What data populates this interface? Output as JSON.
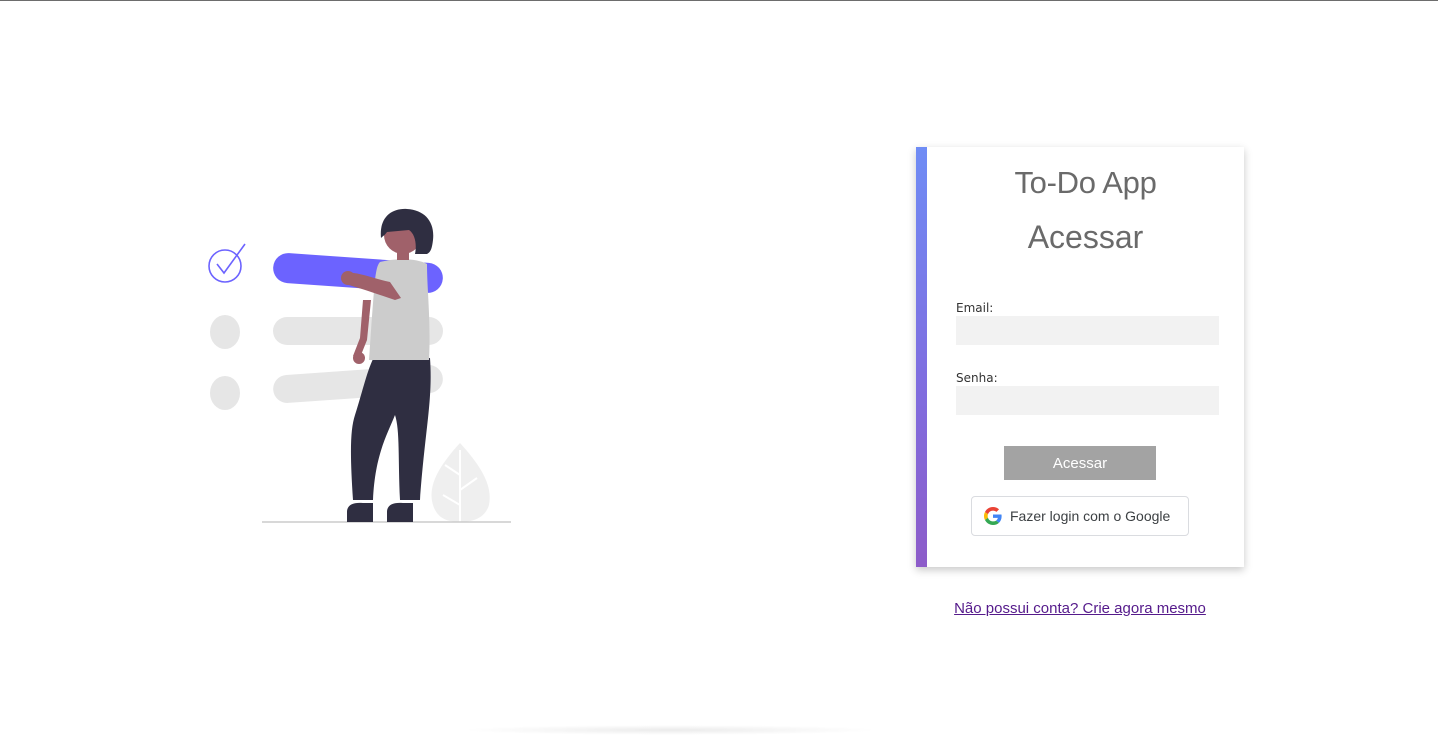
{
  "app": {
    "title": "To-Do App",
    "heading": "Acessar"
  },
  "form": {
    "email_label": "Email:",
    "email_value": "",
    "password_label": "Senha:",
    "password_value": "",
    "submit_label": "Acessar",
    "google_label": "Fazer login com o Google"
  },
  "footer": {
    "signup_link": "Não possui conta? Crie agora mesmo"
  },
  "colors": {
    "accent_top": "#6f8cf5",
    "accent_bottom": "#8d5cc9",
    "illustration_accent": "#6c63ff",
    "button_disabled": "#a3a3a3",
    "link": "#551a8b"
  },
  "icons": {
    "google": "google-g-icon",
    "check": "check-circle-icon"
  }
}
